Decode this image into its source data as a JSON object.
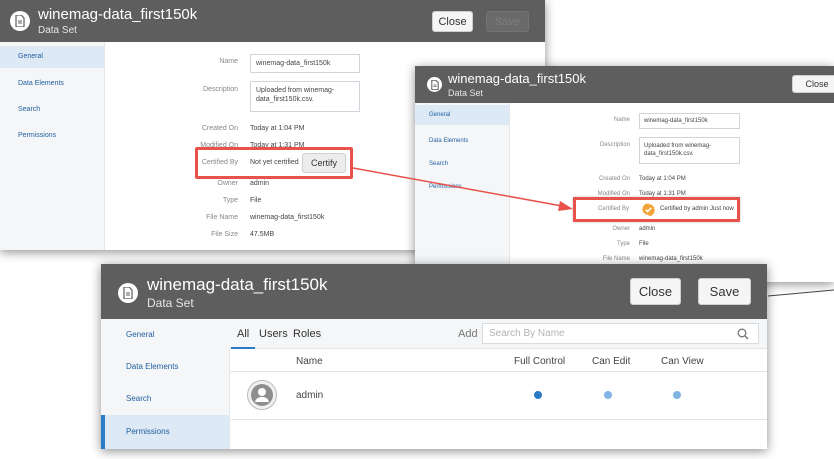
{
  "dataset": {
    "title": "winemag-data_first150k",
    "subtitle": "Data Set"
  },
  "buttons": {
    "close": "Close",
    "save": "Save"
  },
  "sidebar": {
    "items": [
      {
        "label": "General"
      },
      {
        "label": "Data Elements"
      },
      {
        "label": "Search"
      },
      {
        "label": "Permissions"
      }
    ]
  },
  "properties": {
    "name_label": "Name",
    "name_value": "winemag-data_first150k",
    "description_label": "Description",
    "description_value": "Uploaded from winemag-data_first150k.csv.",
    "created_label": "Created On",
    "created_value": "Today at 1:04 PM",
    "modified_label": "Modified On",
    "modified_value": "Today at 1:31 PM",
    "certified_label": "Certified By",
    "certified_value_before": "Not yet certified",
    "certify_button": "Certify",
    "certified_value_after": "Certified by admin Just now",
    "owner_label": "Owner",
    "owner_value": "admin",
    "type_label": "Type",
    "type_value": "File",
    "filename_label": "File Name",
    "filename_value": "winemag-data_first150k",
    "filesize_label": "File Size",
    "filesize_value": "47.5MB"
  },
  "permissions": {
    "tabs": [
      "All",
      "Users",
      "Roles"
    ],
    "add_label": "Add",
    "search_placeholder": "Search By Name",
    "columns": {
      "name": "Name",
      "full_control": "Full Control",
      "can_edit": "Can Edit",
      "can_view": "Can View"
    },
    "rows": [
      {
        "name": "admin"
      }
    ]
  },
  "colors": {
    "header": "#5e5e5e",
    "accent": "#2a7cc7",
    "highlight": "#e8524a",
    "dot_selected": "#2a7cc7",
    "dot_inherited": "#7fb4e3",
    "certified_badge": "#f2a33a"
  },
  "icons": {
    "dataset": "document-icon",
    "search": "search-icon",
    "avatar": "user-avatar-icon",
    "certified": "certified-badge-icon"
  }
}
